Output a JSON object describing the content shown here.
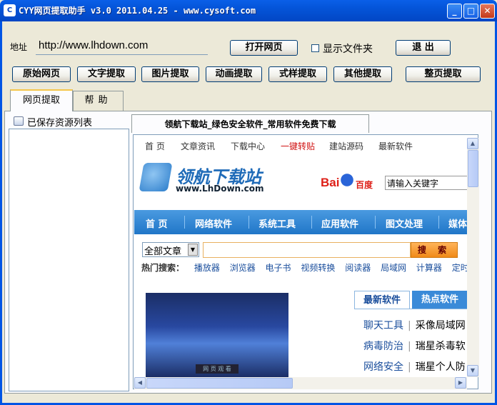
{
  "window": {
    "title": "CYY网页提取助手 v3.0 2011.04.25 - www.cysoft.com",
    "icon_text": "C",
    "controls": {
      "minimize": "_",
      "maximize": "□",
      "close": "✕"
    }
  },
  "toolbar": {
    "address_label": "地址",
    "url_value": "http://www.lhdown.com",
    "open_button": "打开网页",
    "show_folder_label": "显示文件夹",
    "show_folder_checked": false,
    "exit_button": "退 出",
    "extract_buttons": [
      "原始网页",
      "文字提取",
      "图片提取",
      "动画提取",
      "式样提取",
      "其他提取",
      "整页提取"
    ]
  },
  "tabs": [
    {
      "label": "网页提取",
      "active": true
    },
    {
      "label": "帮助",
      "active": false
    }
  ],
  "resources": {
    "title": "已保存资源列表",
    "items": []
  },
  "browser": {
    "tab_title": "领航下载站_绿色安全软件_常用软件免费下载",
    "topnav": [
      "首 页",
      "文章资讯",
      "下载中心",
      "一键转贴",
      "建站源码",
      "最新软件"
    ],
    "topnav_highlight": "一键转贴",
    "logo_title": "领航下载站",
    "logo_url": "www.LhDown.com",
    "baidu_text": "Bai",
    "baidu_cn": "百度",
    "keyword_placeholder": "请输入关键字",
    "mainnav": [
      "首 页",
      "网络软件",
      "系统工具",
      "应用软件",
      "图文处理",
      "媒体"
    ],
    "category_select": "全部文章",
    "search_button": "搜 索",
    "hot_label": "热门搜索：",
    "hot_items": [
      "播放器",
      "浏览器",
      "电子书",
      "视频转换",
      "阅读器",
      "局域网",
      "计算器",
      "定时"
    ],
    "news_tabs": [
      "最新软件",
      "热点软件"
    ],
    "news": [
      {
        "category": "聊天工具",
        "title": "采像局域网"
      },
      {
        "category": "病毒防治",
        "title": "瑞星杀毒软"
      },
      {
        "category": "网络安全",
        "title": "瑞星个人防"
      }
    ],
    "banner_caption": "网 页 观 看"
  },
  "colors": {
    "titlebar": "#0454D8",
    "window_bg": "#ECE9D8",
    "site_blue": "#2076C8",
    "baidu_red": "#DE1F17",
    "search_orange": "#F08A18"
  }
}
